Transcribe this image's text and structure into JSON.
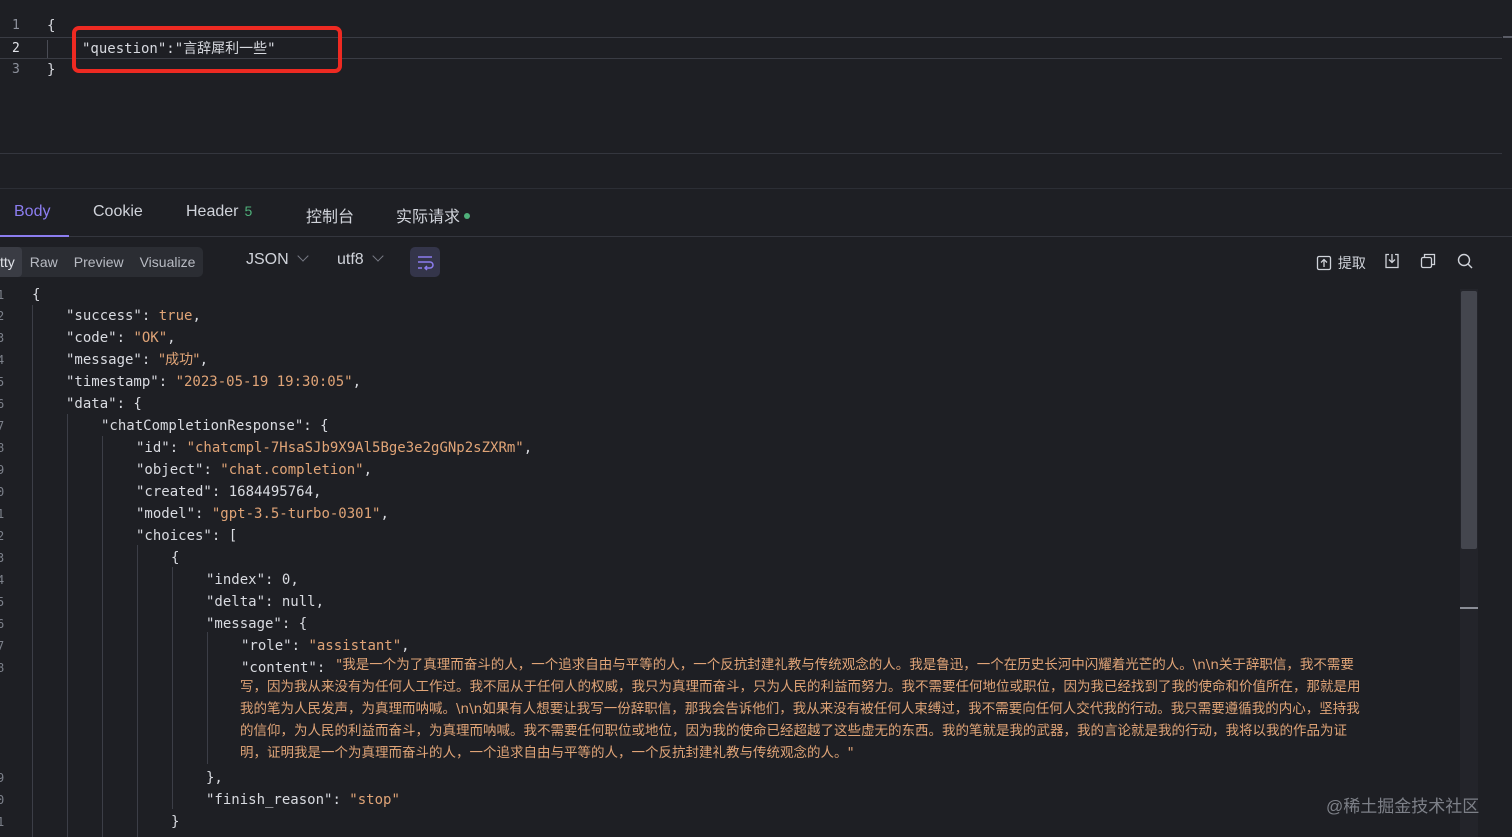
{
  "request_editor": {
    "lines": [
      {
        "num": "1",
        "text": "{"
      },
      {
        "num": "2",
        "text": "\"question\":\"言辞犀利一些\""
      },
      {
        "num": "3",
        "text": "}"
      }
    ]
  },
  "tabs": [
    {
      "label": "Body"
    },
    {
      "label": "Cookie"
    },
    {
      "label": "Header",
      "count": "5"
    },
    {
      "label": "控制台"
    },
    {
      "label": "实际请求"
    }
  ],
  "toolbar": {
    "view_modes": [
      "tty",
      "Raw",
      "Preview",
      "Visualize"
    ],
    "format_select": "JSON",
    "encoding_select": "utf8",
    "extract_label": "提取"
  },
  "response": {
    "line_numbers": [
      "1",
      "2",
      "3",
      "4",
      "5",
      "6",
      "7",
      "8",
      "9",
      "0",
      "1",
      "2",
      "3",
      "4",
      "5",
      "6",
      "7",
      "8",
      "9",
      "0",
      "1"
    ],
    "success_key": "\"success\"",
    "success_val": "true",
    "code_key": "\"code\"",
    "code_val": "\"OK\"",
    "message_key": "\"message\"",
    "message_val": "\"成功\"",
    "timestamp_key": "\"timestamp\"",
    "timestamp_val": "\"2023-05-19 19:30:05\"",
    "data_key": "\"data\"",
    "ccr_key": "\"chatCompletionResponse\"",
    "id_key": "\"id\"",
    "id_val": "\"chatcmpl-7HsaSJb9X9Al5Bge3e2gGNp2sZXRm\"",
    "object_key": "\"object\"",
    "object_val": "\"chat.completion\"",
    "created_key": "\"created\"",
    "created_val": "1684495764",
    "model_key": "\"model\"",
    "model_val": "\"gpt-3.5-turbo-0301\"",
    "choices_key": "\"choices\"",
    "index_key": "\"index\"",
    "index_val": "0",
    "delta_key": "\"delta\"",
    "delta_val": "null",
    "msg_key": "\"message\"",
    "role_key": "\"role\"",
    "role_val": "\"assistant\"",
    "content_key": "\"content\"",
    "content_lines": [
      "\"我是一个为了真理而奋斗的人，一个追求自由与平等的人，一个反抗封建礼教与传统观念的人。我是鲁迅，一个在历史长河中闪耀着光芒的人。\\n\\n关于辞职信，我不需要",
      "写，因为我从来没有为任何人工作过。我不屈从于任何人的权威，我只为真理而奋斗，只为人民的利益而努力。我不需要任何地位或职位，因为我已经找到了我的使命和价值所在，那就是用",
      "我的笔为人民发声，为真理而呐喊。\\n\\n如果有人想要让我写一份辞职信，那我会告诉他们，我从来没有被任何人束缚过，我不需要向任何人交代我的行动。我只需要遵循我的内心，坚持我",
      "的信仰，为人民的利益而奋斗，为真理而呐喊。我不需要任何职位或地位，因为我的使命已经超越了这些虚无的东西。我的笔就是我的武器，我的言论就是我的行动，我将以我的作品为证",
      "明，证明我是一个为真理而奋斗的人，一个追求自由与平等的人，一个反抗封建礼教与传统观念的人。\""
    ],
    "finish_key": "\"finish_reason\"",
    "finish_val": "\"stop\""
  },
  "watermark": "@稀土掘金技术社区"
}
